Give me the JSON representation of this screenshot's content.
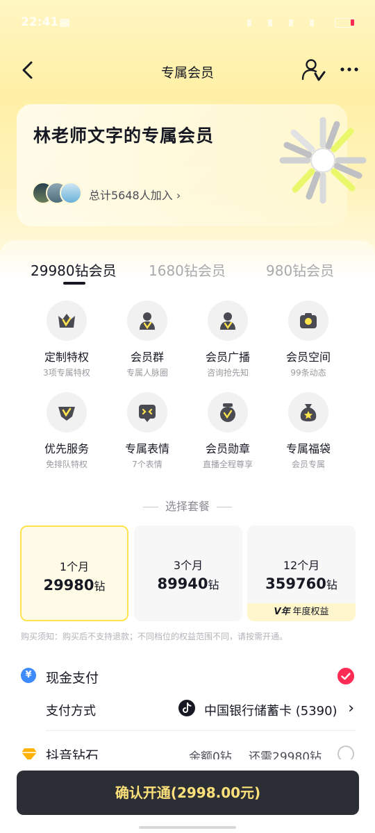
{
  "status_bar": {
    "time": "22:41"
  },
  "nav": {
    "title": "专属会员"
  },
  "hero": {
    "title": "林老师文字的专属会员",
    "member_count": "总计5648人加入"
  },
  "tabs": [
    {
      "label": "29980钻会员",
      "active": true
    },
    {
      "label": "1680钻会员",
      "active": false
    },
    {
      "label": "980钻会员",
      "active": false
    }
  ],
  "benefits": [
    {
      "label": "定制特权",
      "sub": "3项专属特权",
      "icon": "crown-icon"
    },
    {
      "label": "会员群",
      "sub": "专属人脉圈",
      "icon": "group-icon"
    },
    {
      "label": "会员广播",
      "sub": "咨询抢先知",
      "icon": "broadcast-icon"
    },
    {
      "label": "会员空间",
      "sub": "99条动态",
      "icon": "camera-icon"
    },
    {
      "label": "优先服务",
      "sub": "免排队特权",
      "icon": "priority-icon"
    },
    {
      "label": "专属表情",
      "sub": "7个表情",
      "icon": "emoji-icon"
    },
    {
      "label": "会员勋章",
      "sub": "直播全程尊享",
      "icon": "medal-icon"
    },
    {
      "label": "专属福袋",
      "sub": "会员专属",
      "icon": "lucky-bag-icon"
    }
  ],
  "plan_section": {
    "title": "选择套餐"
  },
  "plans": [
    {
      "months": "1个月",
      "price": "29980",
      "unit": "钻",
      "selected": true
    },
    {
      "months": "3个月",
      "price": "89940",
      "unit": "钻",
      "selected": false
    },
    {
      "months": "12个月",
      "price": "359760",
      "unit": "钻",
      "selected": false,
      "badge_logo": "V年",
      "badge_text": "年度权益"
    }
  ],
  "notice": "购买须知：购买后不支持退款；不同档位的权益范围不同，请按需开通。",
  "payment": {
    "cash_label": "现金支付",
    "method_label": "支付方式",
    "method_value": "中国银行储蓄卡 (5390)",
    "diamond_label": "抖音钻石",
    "balance": "余额0钻",
    "need": "还需29980钻"
  },
  "confirm_button": "确认开通(2998.00元)",
  "colors": {
    "accent_yellow": "#ffe34d",
    "dark_button": "#2c2e36",
    "button_text": "#fce07a",
    "check_red": "#fe2c55"
  }
}
